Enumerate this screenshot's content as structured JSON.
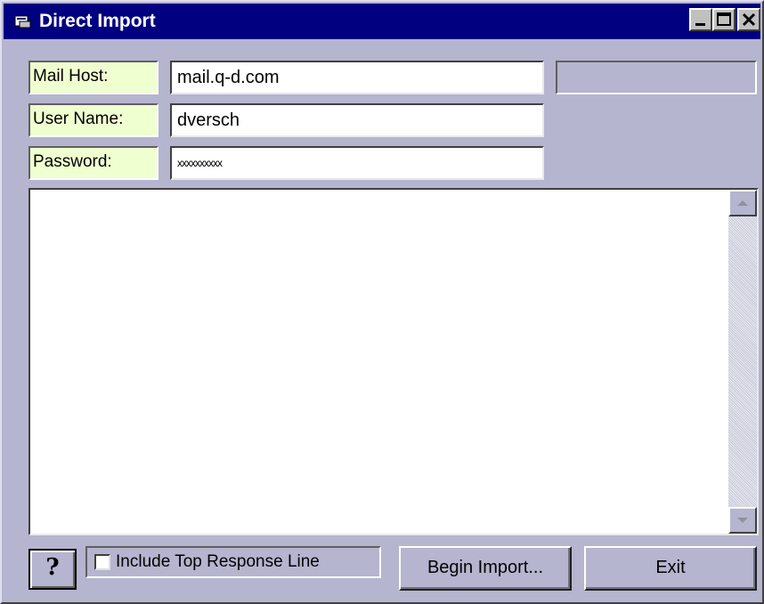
{
  "window": {
    "title": "Direct Import",
    "icon": "app-icon",
    "controls": [
      "minimize-icon",
      "maximize-icon",
      "close-icon"
    ]
  },
  "form": {
    "mail_host": {
      "label": "Mail Host:",
      "value": "mail.q-d.com"
    },
    "user_name": {
      "label": "User Name:",
      "value": "dversch"
    },
    "password": {
      "label": "Password:",
      "value": "xxxxxxxxxx"
    }
  },
  "status_panel": {
    "text": ""
  },
  "log": {
    "text": ""
  },
  "footer": {
    "help_icon": "help-icon",
    "help_glyph": "?",
    "include_top_response": {
      "label": "Include Top Response Line",
      "checked": false
    },
    "begin_import_label": "Begin Import...",
    "exit_label": "Exit"
  },
  "colors": {
    "title_bar": "#000080",
    "window_bg": "#b5b5cf",
    "label_bg": "#f0ffd0"
  }
}
